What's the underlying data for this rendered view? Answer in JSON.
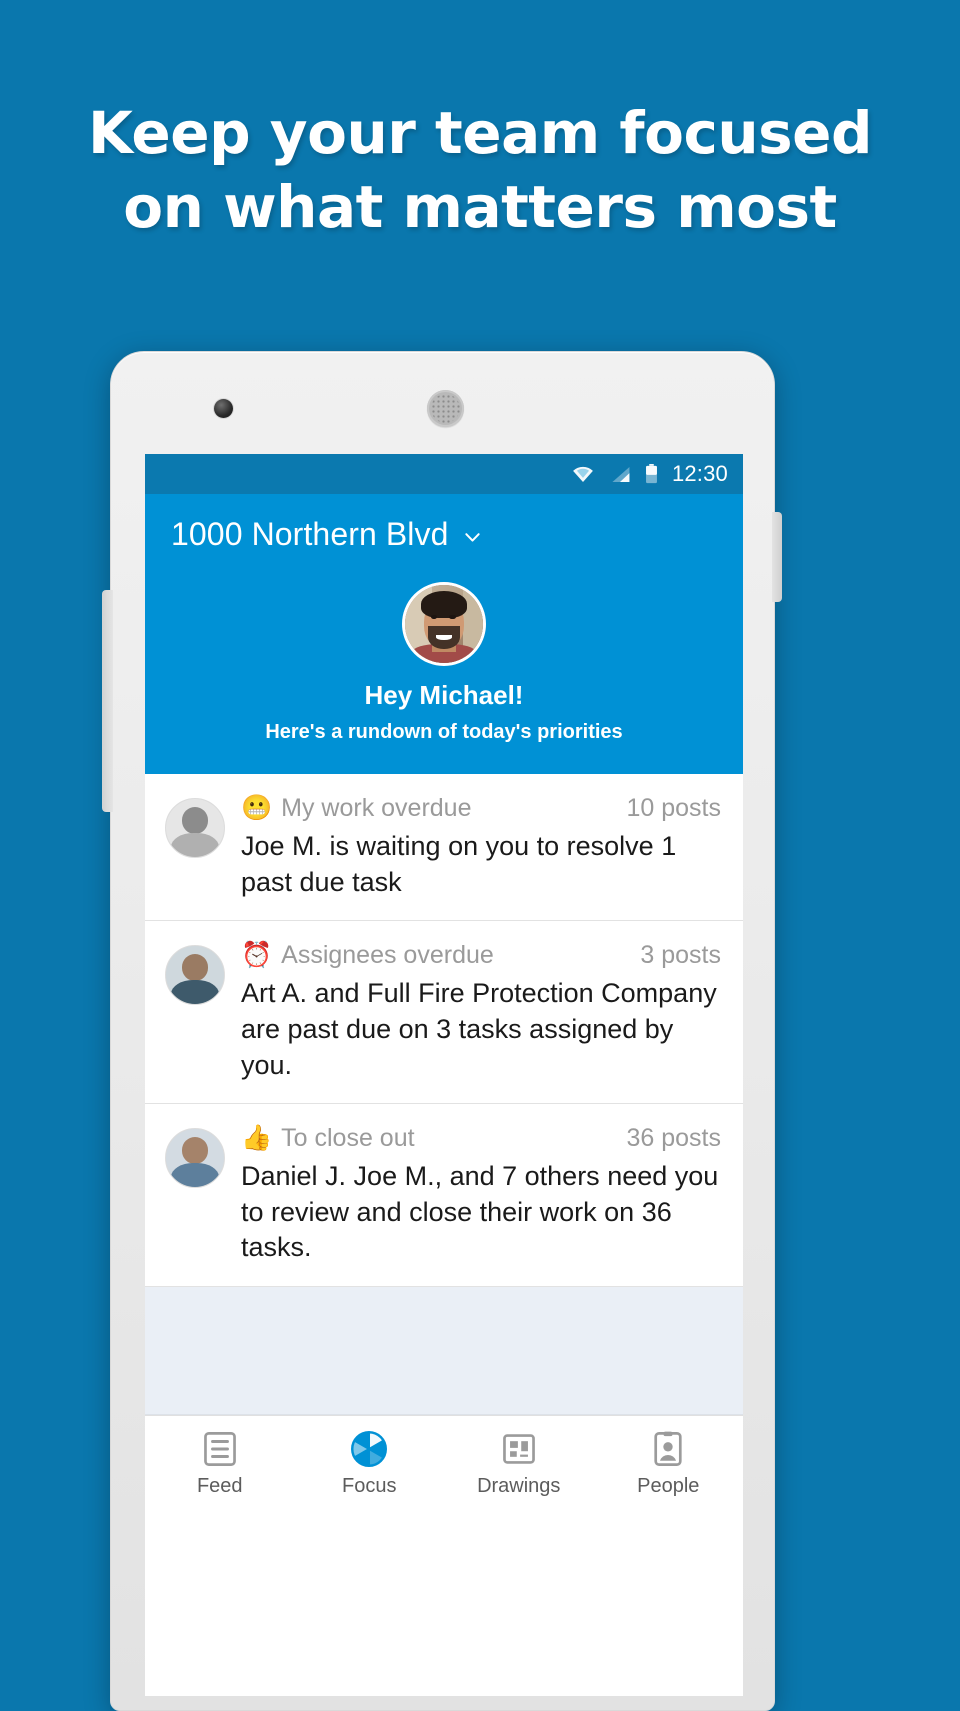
{
  "promo": {
    "line1": "Keep your team focused",
    "line2": "on what matters most",
    "background_color": "#0A77AD"
  },
  "phone": {
    "camera_icon": "front-camera",
    "speaker_icon": "earpiece-speaker"
  },
  "statusbar": {
    "time": "12:30",
    "icons": [
      "wifi-icon",
      "signal-icon",
      "battery-icon"
    ],
    "background_color": "#0B79AF"
  },
  "appbar": {
    "title": "1000 Northern Blvd",
    "chevron_icon": "chevron-down-icon",
    "background_color": "#0091D5"
  },
  "hero": {
    "avatar_icon": "user-avatar",
    "greeting": "Hey Michael!",
    "subtitle": "Here's a rundown of today's priorities"
  },
  "feed": {
    "items": [
      {
        "avatar": "contact-avatar-1",
        "emoji": "😬",
        "category": "My work overdue",
        "count": "10 posts",
        "body": "Joe M. is waiting on you to resolve 1 past due task"
      },
      {
        "avatar": "contact-avatar-2",
        "emoji": "⏰",
        "category": "Assignees overdue",
        "count": "3 posts",
        "body": "Art A. and Full Fire Protection Company are past due on 3 tasks assigned by you."
      },
      {
        "avatar": "contact-avatar-3",
        "emoji": "👍",
        "category": "To close out",
        "count": "36 posts",
        "body": "Daniel J. Joe M., and 7 others need you to review and close their work on 36 tasks."
      }
    ]
  },
  "bottomnav": {
    "items": [
      {
        "label": "Feed",
        "icon": "feed-list-icon",
        "active": false
      },
      {
        "label": "Focus",
        "icon": "aperture-icon",
        "active": true
      },
      {
        "label": "Drawings",
        "icon": "blueprint-icon",
        "active": false
      },
      {
        "label": "People",
        "icon": "person-badge-icon",
        "active": false
      }
    ],
    "active_color": "#0091D5",
    "inactive_color": "#9B9B9B"
  }
}
